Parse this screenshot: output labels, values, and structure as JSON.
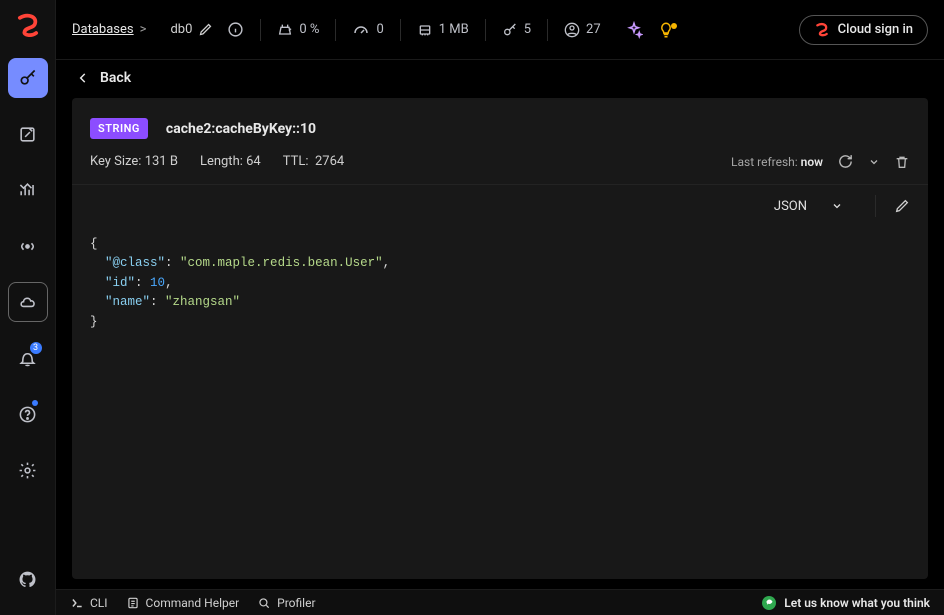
{
  "breadcrumb": {
    "databases_label": "Databases",
    "sep": ">"
  },
  "topbar": {
    "db_name": "db0",
    "cpu_pct": "0 %",
    "commands": "0",
    "memory": "1 MB",
    "keys": "5",
    "clients": "27",
    "cloud_signin": "Cloud sign in"
  },
  "sidebar": {
    "notifications_badge": "3"
  },
  "back_label": "Back",
  "key": {
    "type_badge": "STRING",
    "name": "cache2:cacheByKey::10",
    "size_label": "Key Size:",
    "size_value": "131 B",
    "length_label": "Length:",
    "length_value": "64",
    "ttl_label": "TTL:",
    "ttl_value": "2764",
    "last_refresh_label": "Last refresh:",
    "last_refresh_value": "now",
    "format": "JSON"
  },
  "value": {
    "fields": [
      {
        "key": "@class",
        "type": "string",
        "value": "com.maple.redis.bean.User"
      },
      {
        "key": "id",
        "type": "number",
        "value": 10
      },
      {
        "key": "name",
        "type": "string",
        "value": "zhangsan"
      }
    ]
  },
  "footer": {
    "cli": "CLI",
    "command_helper": "Command Helper",
    "profiler": "Profiler",
    "feedback": "Let us know what you think"
  }
}
